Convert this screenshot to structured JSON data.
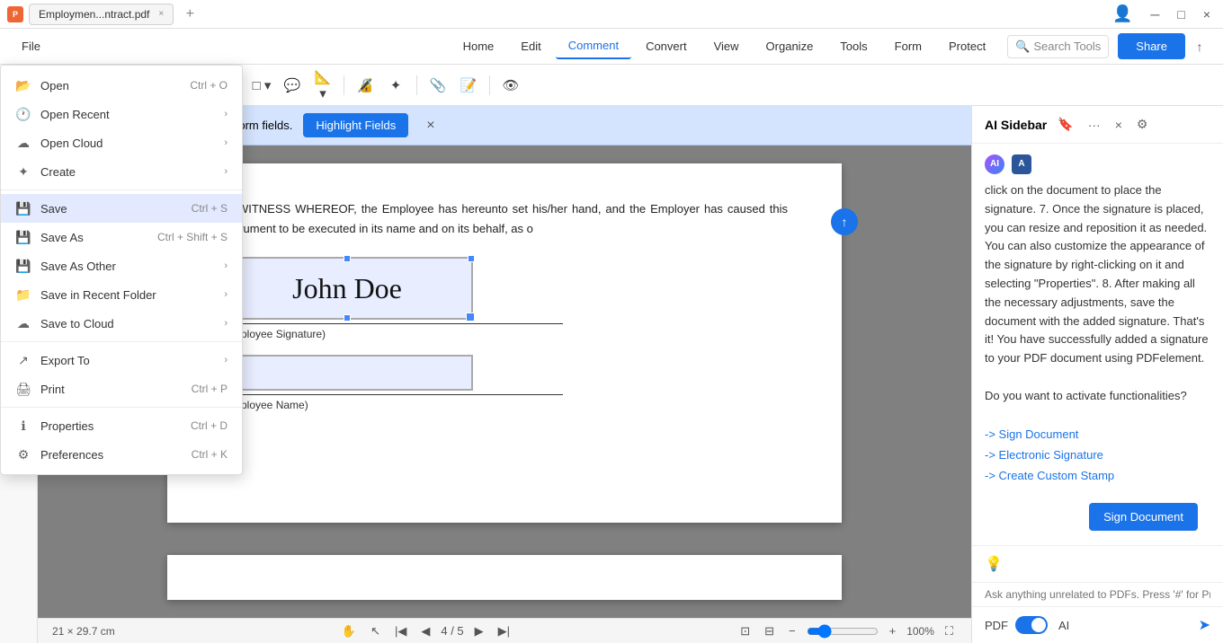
{
  "titleBar": {
    "tabIcon": "PDF",
    "tabLabel": "Employmen...ntract.pdf",
    "addTab": "+",
    "winControls": [
      "_",
      "□",
      "×"
    ]
  },
  "menuBar": {
    "fileLabel": "File",
    "items": [
      {
        "label": "Home",
        "active": false
      },
      {
        "label": "Edit",
        "active": false
      },
      {
        "label": "Comment",
        "active": true
      },
      {
        "label": "Convert",
        "active": false
      },
      {
        "label": "View",
        "active": false
      },
      {
        "label": "Organize",
        "active": false
      },
      {
        "label": "Tools",
        "active": false
      },
      {
        "label": "Form",
        "active": false
      },
      {
        "label": "Protect",
        "active": false
      }
    ],
    "searchPlaceholder": "Search Tools",
    "shareLabel": "Share"
  },
  "fileMenu": {
    "items": [
      {
        "id": "open",
        "icon": "📂",
        "label": "Open",
        "shortcut": "Ctrl + O",
        "hasArrow": false
      },
      {
        "id": "open-recent",
        "icon": "🕐",
        "label": "Open Recent",
        "shortcut": "",
        "hasArrow": true
      },
      {
        "id": "open-cloud",
        "icon": "☁",
        "label": "Open Cloud",
        "shortcut": "",
        "hasArrow": true
      },
      {
        "id": "create",
        "icon": "✦",
        "label": "Create",
        "shortcut": "",
        "hasArrow": true
      },
      {
        "id": "save",
        "icon": "💾",
        "label": "Save",
        "shortcut": "Ctrl + S",
        "hasArrow": false,
        "highlighted": true
      },
      {
        "id": "save-as",
        "icon": "💾",
        "label": "Save As",
        "shortcut": "Ctrl + Shift + S",
        "hasArrow": false
      },
      {
        "id": "save-as-other",
        "icon": "💾",
        "label": "Save As Other",
        "shortcut": "",
        "hasArrow": true
      },
      {
        "id": "save-recent",
        "icon": "📁",
        "label": "Save in Recent Folder",
        "shortcut": "",
        "hasArrow": true
      },
      {
        "id": "save-cloud",
        "icon": "☁",
        "label": "Save to Cloud",
        "shortcut": "",
        "hasArrow": true
      },
      {
        "id": "export",
        "icon": "↗",
        "label": "Export To",
        "shortcut": "",
        "hasArrow": true
      },
      {
        "id": "print",
        "icon": "🖨",
        "label": "Print",
        "shortcut": "Ctrl + P",
        "hasArrow": false
      },
      {
        "id": "properties",
        "icon": "ℹ",
        "label": "Properties",
        "shortcut": "Ctrl + D",
        "hasArrow": false
      },
      {
        "id": "preferences",
        "icon": "⚙",
        "label": "Preferences",
        "shortcut": "Ctrl + K",
        "hasArrow": false
      }
    ]
  },
  "formBar": {
    "text": "This document contains interactive form fields.",
    "highlightLabel": "Highlight Fields",
    "closeLabel": "×"
  },
  "document": {
    "text": "IN WITNESS WHEREOF, the Employee has hereunto set his/her hand, and the Employer has caused this instrument to be executed in its name and on its behalf, as o",
    "signatureLabel": "(Employee Signature)",
    "nameLabel": "(Employee Name)",
    "signatureText": "John Doe"
  },
  "bottomBar": {
    "dimensions": "21 × 29.7 cm",
    "currentPage": "4",
    "totalPages": "5",
    "zoom": "100%"
  },
  "aiSidebar": {
    "title": "AI Sidebar",
    "content": "click on the document to place the signature. 7. Once the signature is placed, you can resize and reposition it as needed. You can also customize the appearance of the signature by right-clicking on it and selecting \"Properties\". 8. After making all the necessary adjustments, save the document with the added signature. That's it! You have successfully added a signature to your PDF document using PDFelement.",
    "prompt": "Do you want to activate functionalities?",
    "links": [
      "-> Sign Document",
      "-> Electronic Signature",
      "-> Create Custom Stamp"
    ],
    "translation": "(Translation: Do you want to activate functionalities? \\n\\n",
    "rawText": "\\n\\n-> Sign Document \\n\\n-> Electronic Signature \\n\\n-> Create Custom Stamp)",
    "signDocLabel": "Sign Document",
    "footerPdfLabel": "PDF",
    "footerAiLabel": "AI",
    "inputPlaceholder": "Ask anything unrelated to PDFs. Press '#' for Prompts."
  }
}
